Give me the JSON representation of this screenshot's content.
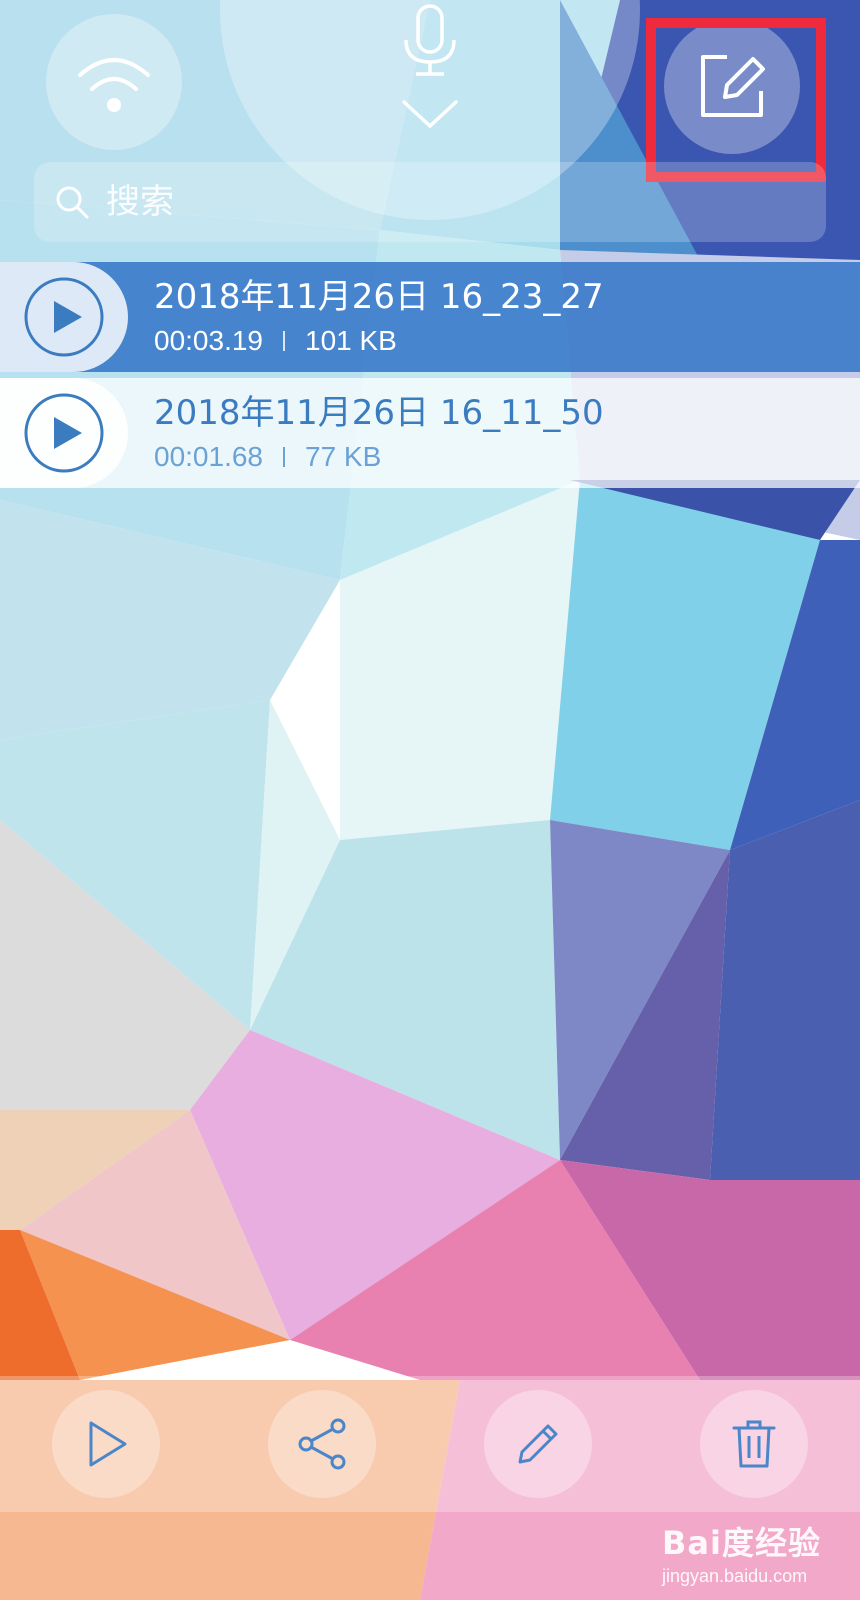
{
  "search": {
    "placeholder": "搜索"
  },
  "recordings": [
    {
      "name": "2018年11月26日 16_23_27",
      "duration": "00:03.19",
      "size": "101 KB",
      "selected": true
    },
    {
      "name": "2018年11月26日 16_11_50",
      "duration": "00:01.68",
      "size": "77 KB",
      "selected": false
    }
  ],
  "toolbar": {
    "wifi_icon": "wifi-icon",
    "mic_icon": "microphone-icon",
    "collapse_icon": "chevron-down-icon",
    "edit_icon": "edit-icon"
  },
  "bottom_actions": [
    "play-icon",
    "share-icon",
    "pencil-icon",
    "trash-icon"
  ],
  "watermark": {
    "main": "Bai度经验",
    "sub": "jingyan.baidu.com"
  },
  "colors": {
    "accent_blue": "#3b7cc0",
    "highlight_red": "#ee2a3c"
  }
}
